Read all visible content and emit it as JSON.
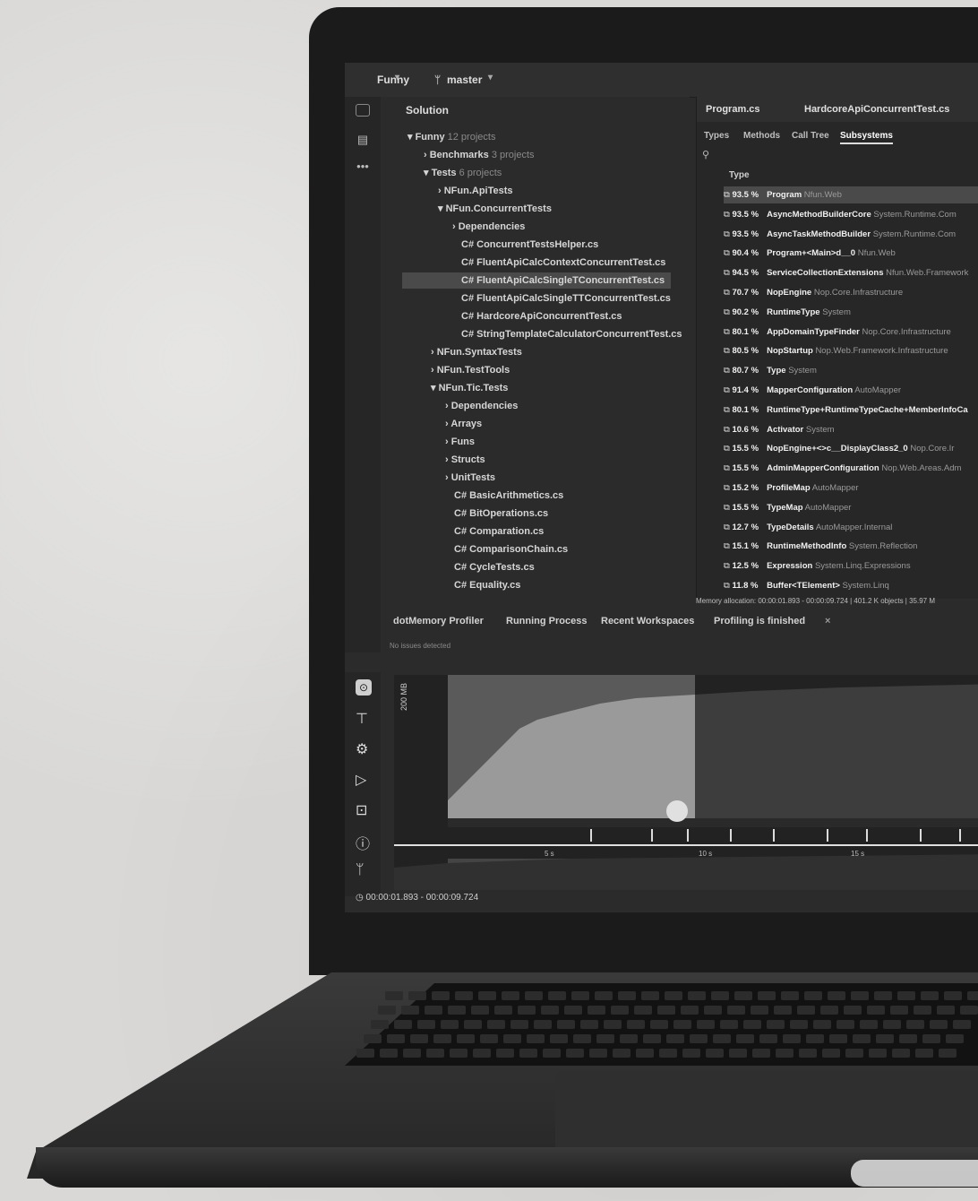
{
  "toolbar": {
    "project_label": "Funny",
    "branch_label": "master"
  },
  "solution": {
    "label": "Solution"
  },
  "tree": {
    "root": "Funny",
    "root_meta": "12 projects",
    "items": [
      {
        "label": "Benchmarks",
        "meta": "3 projects"
      },
      {
        "label": "Tests",
        "meta": "6 projects"
      },
      {
        "label": "NFun.ApiTests",
        "meta": ""
      },
      {
        "label": "NFun.ConcurrentTests",
        "meta": ""
      },
      {
        "label": "Dependencies",
        "meta": ""
      },
      {
        "label": "ConcurrentTestsHelper.cs",
        "meta": ""
      },
      {
        "label": "FluentApiCalcContextConcurrentTest.cs",
        "meta": ""
      },
      {
        "label": "FluentApiCalcSingleTConcurrentTest.cs",
        "meta": ""
      },
      {
        "label": "FluentApiCalcSingleTTConcurrentTest.cs",
        "meta": ""
      },
      {
        "label": "HardcoreApiConcurrentTest.cs",
        "meta": ""
      },
      {
        "label": "StringTemplateCalculatorConcurrentTest.cs",
        "meta": ""
      },
      {
        "label": "NFun.SyntaxTests",
        "meta": ""
      },
      {
        "label": "NFun.TestTools",
        "meta": ""
      },
      {
        "label": "NFun.Tic.Tests",
        "meta": ""
      },
      {
        "label": "Dependencies",
        "meta": ""
      },
      {
        "label": "Arrays",
        "meta": ""
      },
      {
        "label": "Funs",
        "meta": ""
      },
      {
        "label": "Structs",
        "meta": ""
      },
      {
        "label": "UnitTests",
        "meta": ""
      },
      {
        "label": "BasicArithmetics.cs",
        "meta": ""
      },
      {
        "label": "BitOperations.cs",
        "meta": ""
      },
      {
        "label": "Comparation.cs",
        "meta": ""
      },
      {
        "label": "ComparisonChain.cs",
        "meta": ""
      },
      {
        "label": "CycleTests.cs",
        "meta": ""
      },
      {
        "label": "Equality.cs",
        "meta": ""
      }
    ]
  },
  "editor_tabs": [
    "Program.cs",
    "HardcoreApiConcurrentTest.cs"
  ],
  "subtabs": [
    "Types",
    "Methods",
    "Call Tree",
    "Subsystems"
  ],
  "type_header": "Type",
  "allocations": [
    {
      "pct": "93.5 %",
      "name": "Program",
      "ns": "Nfun.Web"
    },
    {
      "pct": "93.5 %",
      "name": "AsyncMethodBuilderCore",
      "ns": "System.Runtime.Com"
    },
    {
      "pct": "93.5 %",
      "name": "AsyncTaskMethodBuilder",
      "ns": "System.Runtime.Com"
    },
    {
      "pct": "90.4 %",
      "name": "Program+<Main>d__0",
      "ns": "Nfun.Web"
    },
    {
      "pct": "94.5 %",
      "name": "ServiceCollectionExtensions",
      "ns": "Nfun.Web.Framework"
    },
    {
      "pct": "70.7 %",
      "name": "NopEngine",
      "ns": "Nop.Core.Infrastructure"
    },
    {
      "pct": "90.2 %",
      "name": "RuntimeType",
      "ns": "System"
    },
    {
      "pct": "80.1 %",
      "name": "AppDomainTypeFinder",
      "ns": "Nop.Core.Infrastructure"
    },
    {
      "pct": "80.5 %",
      "name": "NopStartup",
      "ns": "Nop.Web.Framework.Infrastructure"
    },
    {
      "pct": "80.7 %",
      "name": "Type",
      "ns": "System"
    },
    {
      "pct": "91.4 %",
      "name": "MapperConfiguration",
      "ns": "AutoMapper"
    },
    {
      "pct": "80.1 %",
      "name": "RuntimeType+RuntimeTypeCache+MemberInfoCa",
      "ns": ""
    },
    {
      "pct": "10.6 %",
      "name": "Activator",
      "ns": "System"
    },
    {
      "pct": "15.5 %",
      "name": "NopEngine+<>c__DisplayClass2_0",
      "ns": "Nop.Core.Ir"
    },
    {
      "pct": "15.5 %",
      "name": "AdminMapperConfiguration",
      "ns": "Nop.Web.Areas.Adm"
    },
    {
      "pct": "15.2 %",
      "name": "ProfileMap",
      "ns": "AutoMapper"
    },
    {
      "pct": "15.5 %",
      "name": "TypeMap",
      "ns": "AutoMapper"
    },
    {
      "pct": "12.7 %",
      "name": "TypeDetails",
      "ns": "AutoMapper.Internal"
    },
    {
      "pct": "15.1 %",
      "name": "RuntimeMethodInfo",
      "ns": "System.Reflection"
    },
    {
      "pct": "12.5 %",
      "name": "Expression",
      "ns": "System.Linq.Expressions"
    },
    {
      "pct": "11.8 %",
      "name": "Buffer<TElement>",
      "ns": "System.Linq"
    }
  ],
  "status_line": "Memory allocation: 00:00:01.893 - 00:00:09.724 | 401.2 K objects | 35.97 M",
  "profiler_tabs": [
    "dotMemory Profiler",
    "Running Process",
    "Recent Workspaces",
    "Profiling is finished"
  ],
  "profiler_note": "No issues detected",
  "chart_axis_label": "200 MB",
  "chart_ticks": [
    "5 s",
    "10 s",
    "15 s"
  ],
  "time_range": "00:00:01.893 - 00:00:09.724",
  "icons": {
    "folder": "folder-icon",
    "structure": "structure-icon",
    "more": "more-icon",
    "profiler": "profiler-icon",
    "run": "run-icon",
    "snapshot": "snapshot-icon",
    "info": "info-icon",
    "close": "close-icon"
  }
}
